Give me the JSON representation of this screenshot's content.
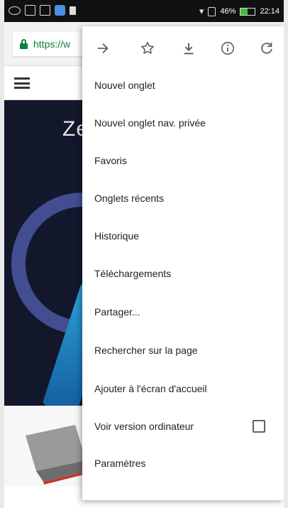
{
  "status_bar": {
    "battery_percent": "46%",
    "battery_level": 0.46,
    "time": "22:14"
  },
  "browser": {
    "url_partial": "https://w"
  },
  "hero": {
    "title_fragment": "Ze"
  },
  "menu": {
    "toolbar": [
      {
        "name": "forward",
        "icon": "arrow-right-icon"
      },
      {
        "name": "bookmark",
        "icon": "star-icon"
      },
      {
        "name": "download",
        "icon": "download-icon"
      },
      {
        "name": "page-info",
        "icon": "info-icon"
      },
      {
        "name": "reload",
        "icon": "refresh-icon"
      }
    ],
    "items": [
      {
        "label": "Nouvel onglet"
      },
      {
        "label": "Nouvel onglet nav. privée"
      },
      {
        "label": "Favoris"
      },
      {
        "label": "Onglets récents"
      },
      {
        "label": "Historique"
      },
      {
        "label": "Téléchargements"
      },
      {
        "label": "Partager..."
      },
      {
        "label": "Rechercher sur la page"
      },
      {
        "label": "Ajouter à l'écran d'accueil"
      },
      {
        "label": "Voir version ordinateur",
        "checkbox": false
      },
      {
        "label": "Paramètres"
      }
    ]
  },
  "colors": {
    "secure_green": "#0b8043",
    "hero_bg": "#12172b",
    "status_bar_bg": "#111111"
  }
}
